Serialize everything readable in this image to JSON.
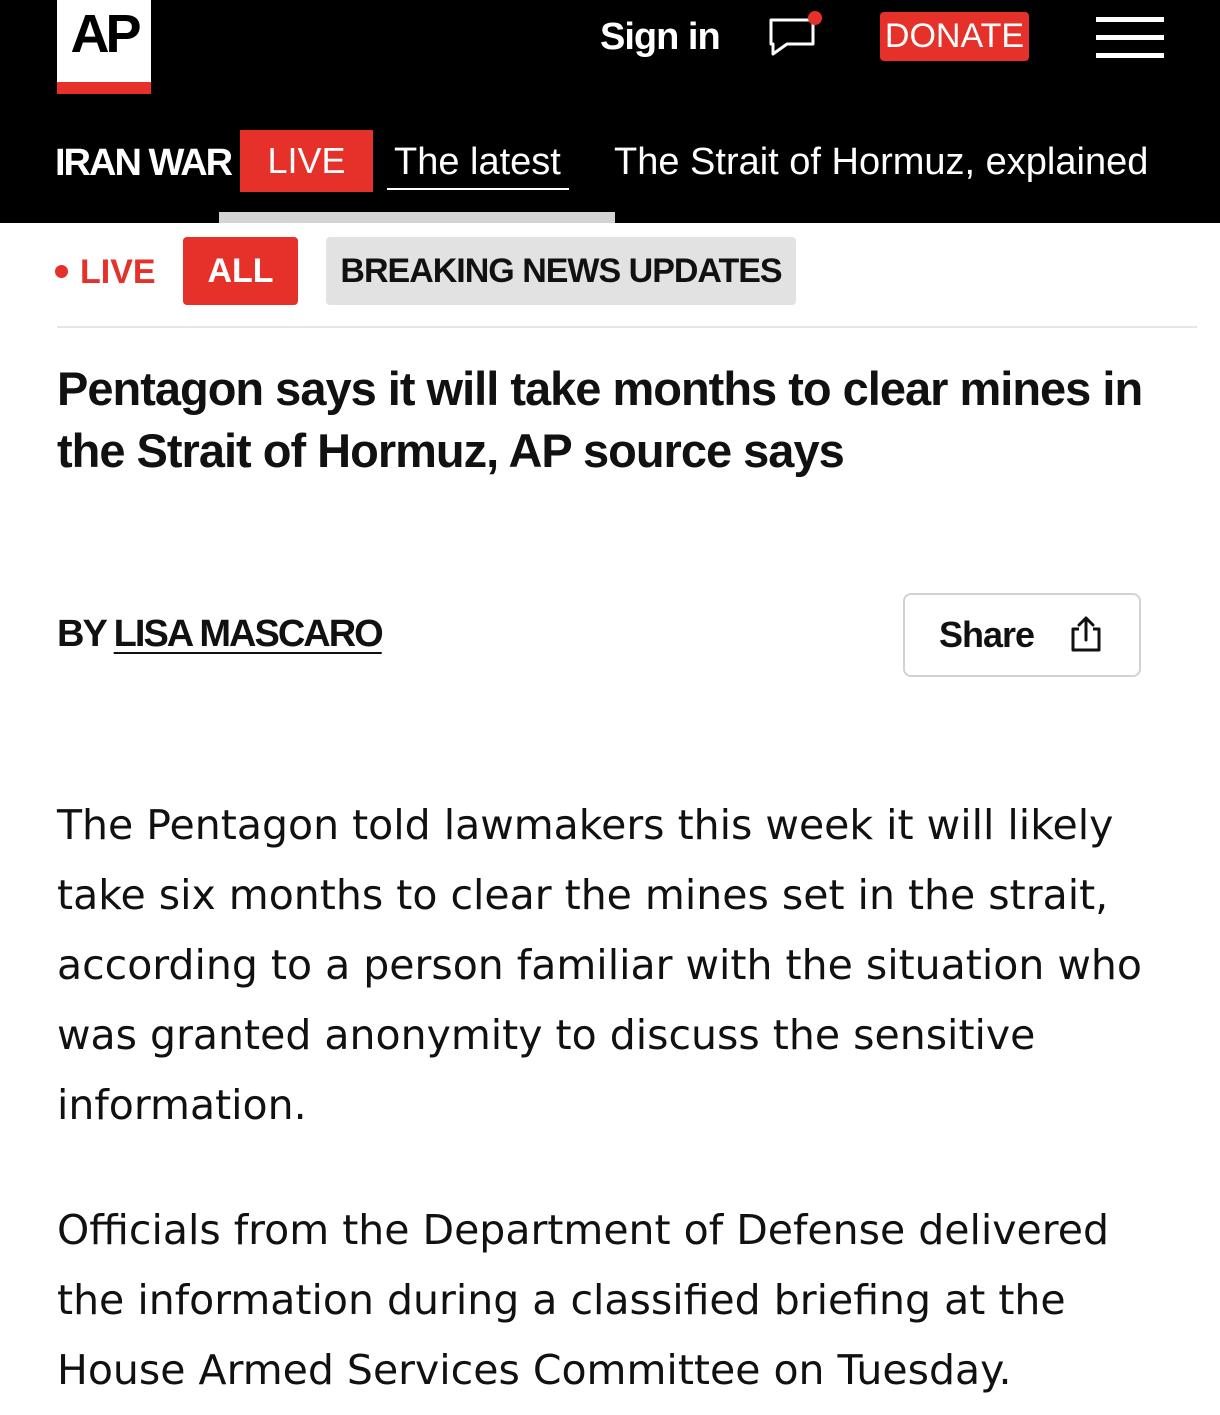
{
  "header": {
    "logo_text": "AP",
    "sign_in_label": "Sign in",
    "donate_label": "DONATE",
    "colors": {
      "accent": "#e5312a",
      "bar": "#000000"
    }
  },
  "topic_nav": {
    "topic_label": "IRAN WAR",
    "live_label": "LIVE",
    "links": [
      {
        "label": "The latest"
      },
      {
        "label": "The Strait of Hormuz, explained"
      }
    ]
  },
  "filters": {
    "live_label": "LIVE",
    "all_label": "ALL",
    "breaking_label": "BREAKING NEWS UPDATES"
  },
  "article": {
    "headline": "Pentagon says it will take months to clear mines in the Strait of Hormuz, AP source says",
    "byline_prefix": "BY",
    "author": "LISA MASCARO",
    "share_label": "Share",
    "paragraphs": [
      "The Pentagon told lawmakers this week it will likely take six months to clear the mines set in the strait, according to a person familiar with the situation who was granted anonymity to discuss the sensitive information.",
      "Officials from the Department of Defense delivered the information during a classified briefing at the House Armed Services Committee on Tuesday."
    ]
  },
  "icons": {
    "chat": "chat-bubble-notification-icon",
    "menu": "hamburger-menu-icon",
    "share": "share-upload-icon"
  }
}
